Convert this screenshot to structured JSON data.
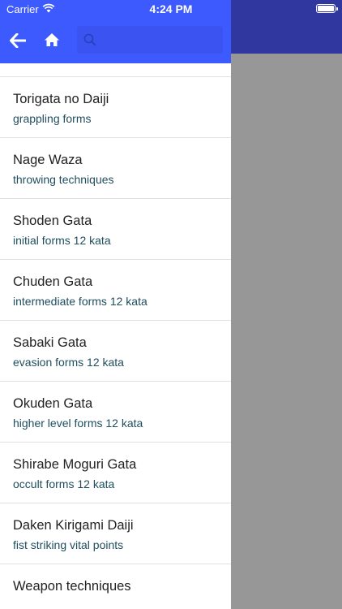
{
  "status_bar": {
    "carrier": "Carrier",
    "time": "4:24 PM"
  },
  "header": {
    "back_icon": "arrow-left-icon",
    "home_icon": "home-icon",
    "search_icon": "search-icon",
    "search_value": "",
    "accent_color": "#3d5afe"
  },
  "menu": {
    "items": [
      {
        "title": "Torigata no Daiji",
        "subtitle": "grappling forms"
      },
      {
        "title": "Nage Waza",
        "subtitle": "throwing techniques"
      },
      {
        "title": "Shoden Gata",
        "subtitle": "initial forms 12 kata"
      },
      {
        "title": "Chuden Gata",
        "subtitle": "intermediate forms 12 kata"
      },
      {
        "title": "Sabaki Gata",
        "subtitle": "evasion forms 12 kata"
      },
      {
        "title": "Okuden Gata",
        "subtitle": "higher level forms 12 kata"
      },
      {
        "title": "Shirabe Moguri Gata",
        "subtitle": "occult forms 12 kata"
      },
      {
        "title": "Daken Kirigami Daiji",
        "subtitle": "fist striking vital points"
      },
      {
        "title": "Weapon techniques",
        "subtitle": ""
      }
    ]
  }
}
